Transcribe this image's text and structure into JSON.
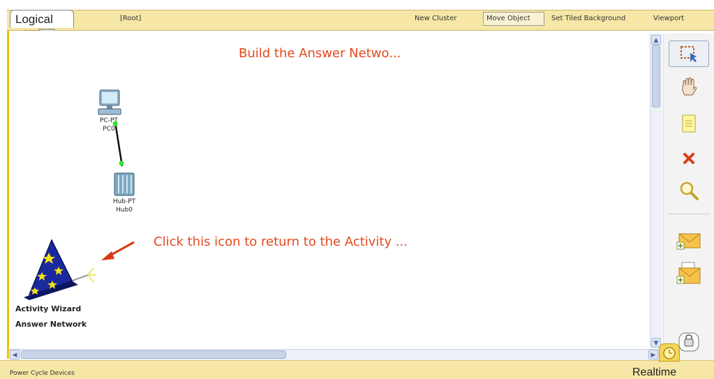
{
  "toolbar": {
    "mode_tab": "Logical",
    "root": "[Root]",
    "new_cluster": "New Cluster",
    "move_object": "Move Object",
    "set_tiled_background": "Set Tiled Background",
    "viewport": "Viewport"
  },
  "canvas": {
    "title_note": "Build the Answer Netwo...",
    "instruction_note": "Click this icon to return to the Activity ...",
    "devices": [
      {
        "type": "PC-PT",
        "name": "PC0",
        "icon": "pc-icon"
      },
      {
        "type": "Hub-PT",
        "name": "Hub0",
        "icon": "hub-icon"
      }
    ],
    "wizard": {
      "line1": "Activity Wizard",
      "line2": "Answer Network",
      "icon": "wizard-hat-icon"
    }
  },
  "palette": {
    "tools": [
      "select-icon",
      "hand-icon",
      "note-icon",
      "delete-icon",
      "zoom-icon",
      "simple-pdu-icon",
      "complex-pdu-icon",
      "lock-icon"
    ]
  },
  "status": {
    "bottom_left": "Power Cycle Devices",
    "mode": "Realtime"
  },
  "colors": {
    "accent_bar": "#f6e7a6",
    "note_text": "#e24a1e",
    "link_indicator": "#2ee62e"
  }
}
